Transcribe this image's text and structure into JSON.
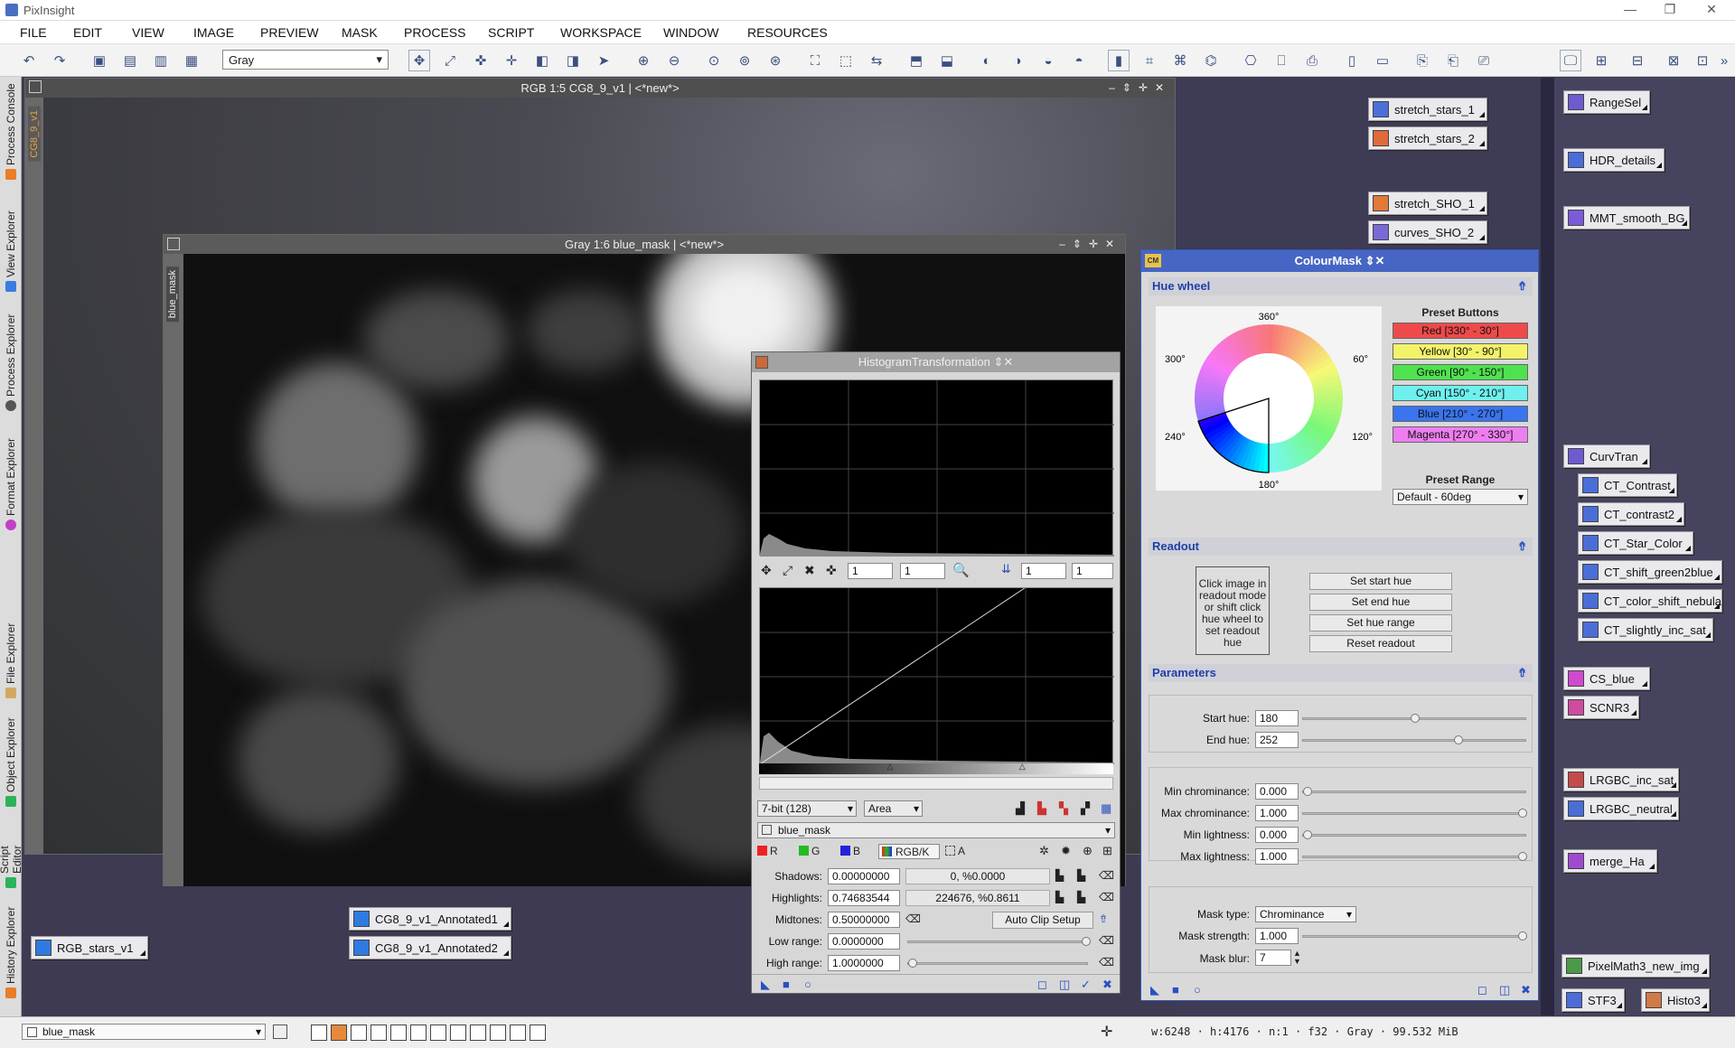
{
  "app": {
    "title": "PixInsight",
    "menu": [
      "FILE",
      "EDIT",
      "VIEW",
      "IMAGE",
      "PREVIEW",
      "MASK",
      "PROCESS",
      "SCRIPT",
      "WORKSPACE",
      "WINDOW",
      "RESOURCES"
    ]
  },
  "toolbar": {
    "view_mode": "Gray"
  },
  "left_tabs": [
    "Process Console",
    "View Explorer",
    "Process Explorer",
    "Format Explorer",
    "File Explorer",
    "Object Explorer",
    "Script Editor",
    "History Explorer"
  ],
  "windows": {
    "rgb": {
      "title": "RGB 1:5 CG8_9_v1 | <*new*>",
      "sidetab": "CG8_9_v1"
    },
    "gray": {
      "title": "Gray 1:6 blue_mask | <*new*>",
      "sidetab": "blue_mask"
    }
  },
  "histogram": {
    "title": "HistogramTransformation",
    "zoom_h": "1",
    "zoom_v": "1",
    "zoom_h2": "1",
    "zoom_v2": "1",
    "bit_depth": "7-bit (128)",
    "plot_mode": "Area",
    "view": "blue_mask",
    "channels": [
      "R",
      "G",
      "B",
      "RGB/K",
      "A"
    ],
    "rows": [
      {
        "label": "Shadows:",
        "value": "0.00000000",
        "stat": "0, %0.0000"
      },
      {
        "label": "Highlights:",
        "value": "0.74683544",
        "stat": "224676, %0.8611"
      },
      {
        "label": "Midtones:",
        "value": "0.50000000",
        "button": "Auto Clip Setup"
      },
      {
        "label": "Low range:",
        "value": "0.0000000"
      },
      {
        "label": "High range:",
        "value": "1.0000000"
      }
    ],
    "curve_levels": {
      "shadows": 0.0,
      "highlights": 0.74683544,
      "midtones": 0.5
    }
  },
  "colourmask": {
    "title": "ColourMask",
    "icon": "CM",
    "sections": {
      "hue": "Hue wheel",
      "readout": "Readout",
      "params": "Parameters"
    },
    "wheel_labels": {
      "top": "360°",
      "right_top": "60°",
      "right_bottom": "120°",
      "bottom": "180°",
      "left_bottom": "240°",
      "left_top": "300°"
    },
    "preset_title": "Preset Buttons",
    "presets": [
      {
        "label": "Red [330° - 30°]",
        "color": "#ee4a4a"
      },
      {
        "label": "Yellow [30° - 90°]",
        "color": "#f3f36a"
      },
      {
        "label": "Green [90° - 150°]",
        "color": "#4fe24f"
      },
      {
        "label": "Cyan [150° - 210°]",
        "color": "#6ff0ee"
      },
      {
        "label": "Blue [210° - 270°]",
        "color": "#3a74ee"
      },
      {
        "label": "Magenta [270° - 330°]",
        "color": "#ee7ef0"
      }
    ],
    "preset_range_label": "Preset Range",
    "preset_range": "Default - 60deg",
    "readout_text": "Click image in readout mode or shift click hue wheel to set readout hue",
    "readout_buttons": [
      "Set start hue",
      "Set end hue",
      "Set hue range",
      "Reset readout"
    ],
    "start_hue_label": "Start hue:",
    "start_hue": "180",
    "end_hue_label": "End hue:",
    "end_hue": "252",
    "min_chroma_label": "Min chrominance:",
    "min_chroma": "0.000",
    "max_chroma_label": "Max chrominance:",
    "max_chroma": "1.000",
    "min_light_label": "Min lightness:",
    "min_light": "0.000",
    "max_light_label": "Max lightness:",
    "max_light": "1.000",
    "mask_type_label": "Mask type:",
    "mask_type": "Chrominance",
    "mask_strength_label": "Mask strength:",
    "mask_strength": "1.000",
    "mask_blur_label": "Mask blur:",
    "mask_blur": "7"
  },
  "desktop_icons": {
    "center": [
      "stretch_stars_1",
      "stretch_stars_2",
      "stretch_SHO_1",
      "curves_SHO_2"
    ],
    "right": [
      "RangeSel",
      "HDR_details",
      "MMT_smooth_BG",
      "CurvTran",
      "CT_Contrast",
      "CT_contrast2",
      "CT_Star_Color",
      "CT_shift_green2blue",
      "CT_color_shift_nebula",
      "CT_slightly_inc_sat",
      "CS_blue",
      "SCNR3",
      "LRGBC_inc_sat",
      "LRGBC_neutral",
      "merge_Ha",
      "PixelMath3_new_img",
      "STF3",
      "Histo3"
    ],
    "images": [
      "RGB_stars_v1",
      "CG8_9_v1_Annotated1",
      "CG8_9_v1_Annotated2"
    ]
  },
  "status": {
    "view": "blue_mask",
    "info": "w:6248 · h:4176 · n:1 · f32 · Gray · 99.532 MiB"
  }
}
